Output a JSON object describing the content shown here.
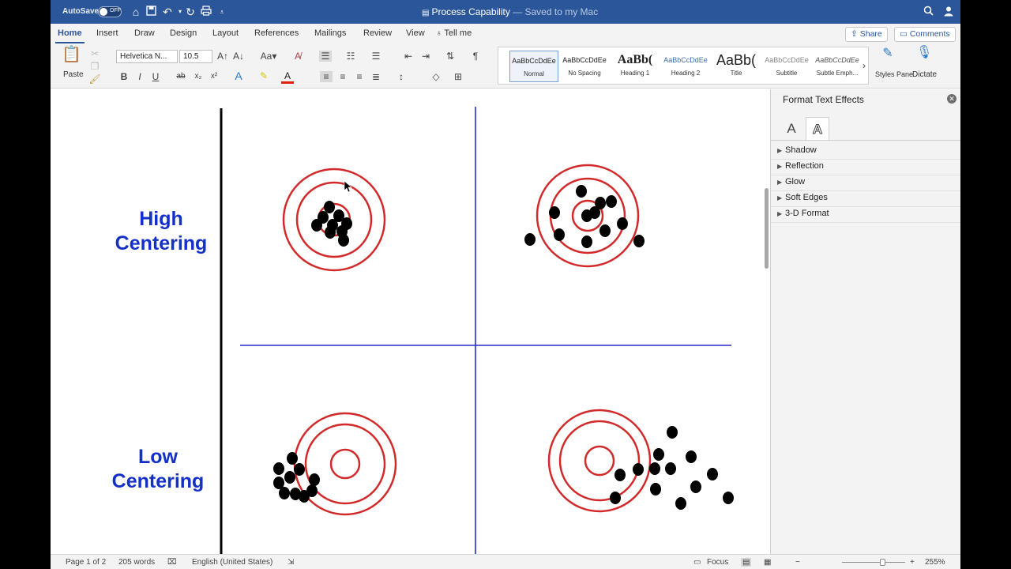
{
  "titlebar": {
    "autosave_label": "AutoSave",
    "autosave_state": "OFF",
    "doc_title": "Process Capability",
    "doc_status": " — Saved to my Mac"
  },
  "tabs": [
    "Home",
    "Insert",
    "Draw",
    "Design",
    "Layout",
    "References",
    "Mailings",
    "Review",
    "View"
  ],
  "tell_me": "Tell me",
  "share_label": "Share",
  "comments_label": "Comments",
  "ribbon": {
    "paste_label": "Paste",
    "font_name": "Helvetica N...",
    "font_size": "10.5",
    "styles": [
      {
        "sample": "AaBbCcDdEe",
        "name": "Normal"
      },
      {
        "sample": "AaBbCcDdEe",
        "name": "No Spacing"
      },
      {
        "sample": "AaBb(",
        "name": "Heading 1"
      },
      {
        "sample": "AaBbCcDdEe",
        "name": "Heading 2"
      },
      {
        "sample": "AaBb(",
        "name": "Title"
      },
      {
        "sample": "AaBbCcDdEe",
        "name": "Subtitle"
      },
      {
        "sample": "AaBbCcDdEe",
        "name": "Subtle Emph..."
      }
    ],
    "styles_pane_label": "Styles Pane",
    "dictate_label": "Dictate"
  },
  "document": {
    "high_line1": "High",
    "high_line2": "Centering",
    "low_line1": "Low",
    "low_line2": "Centering"
  },
  "pane": {
    "title": "Format Text Effects",
    "sections": [
      "Shadow",
      "Reflection",
      "Glow",
      "Soft Edges",
      "3-D Format"
    ]
  },
  "status": {
    "page": "Page 1 of 2",
    "words": "205 words",
    "language": "English (United States)",
    "focus": "Focus",
    "zoom": "255%"
  },
  "colors": {
    "brand": "#2b579a",
    "target_ring": "#d22a2a",
    "divider_line": "#2a2ad0",
    "label_text": "#1530c8"
  }
}
